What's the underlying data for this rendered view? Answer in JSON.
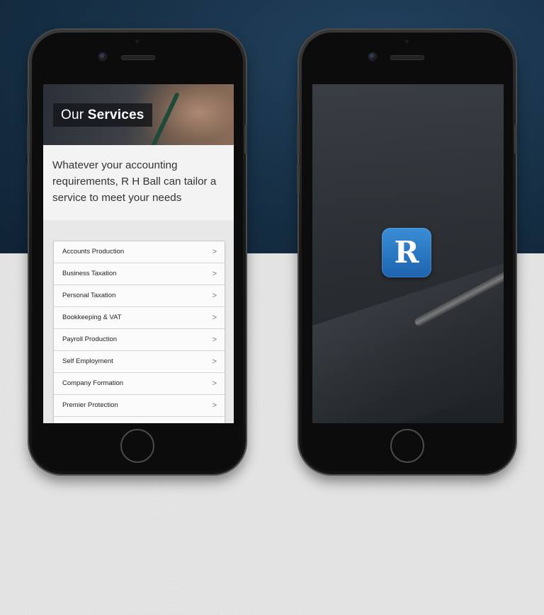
{
  "left_screen": {
    "hero_title_light": "Our ",
    "hero_title_bold": "Services",
    "intro_text": "Whatever your accounting requirements, R H Ball can tailor a service to meet your needs",
    "services": [
      {
        "label": "Accounts Production"
      },
      {
        "label": "Business Taxation"
      },
      {
        "label": "Personal Taxation"
      },
      {
        "label": "Bookkeeping & VAT"
      },
      {
        "label": "Payroll Production"
      },
      {
        "label": "Self Employment"
      },
      {
        "label": "Company Formation"
      },
      {
        "label": "Premier Protection"
      }
    ],
    "chevron_icon": "chevron-right-icon"
  },
  "right_screen": {
    "app_icon_letter": "R"
  },
  "colors": {
    "background_top": "#183249",
    "background_bottom": "#e4e4e4",
    "app_icon_blue": "#2a78c4"
  }
}
